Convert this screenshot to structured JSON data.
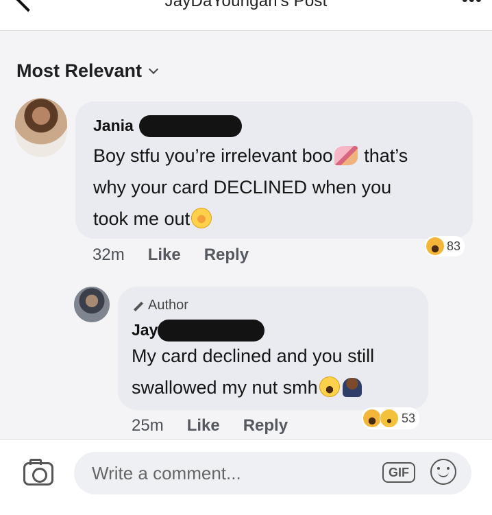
{
  "header": {
    "title": "JayDaYoungan's Post",
    "more_icon": "more-dots-icon"
  },
  "sort": {
    "label": "Most Relevant"
  },
  "comments": [
    {
      "name": "Jania",
      "text_part1": "Boy stfu you’re irrelevant boo",
      "text_part2": " that’s",
      "text_part3": "why your card DECLINED when you",
      "text_part4": "took me out",
      "time": "32m",
      "like": "Like",
      "reply": "Reply",
      "reaction_count": "83"
    },
    {
      "author_badge": "Author",
      "name": "Jay",
      "text_part1": "My card declined and you still",
      "text_part2": "swallowed my nut smh",
      "time": "25m",
      "like": "Like",
      "reply": "Reply",
      "reaction_count": "53"
    }
  ],
  "composer": {
    "placeholder": "Write a comment...",
    "gif_label": "GIF"
  }
}
